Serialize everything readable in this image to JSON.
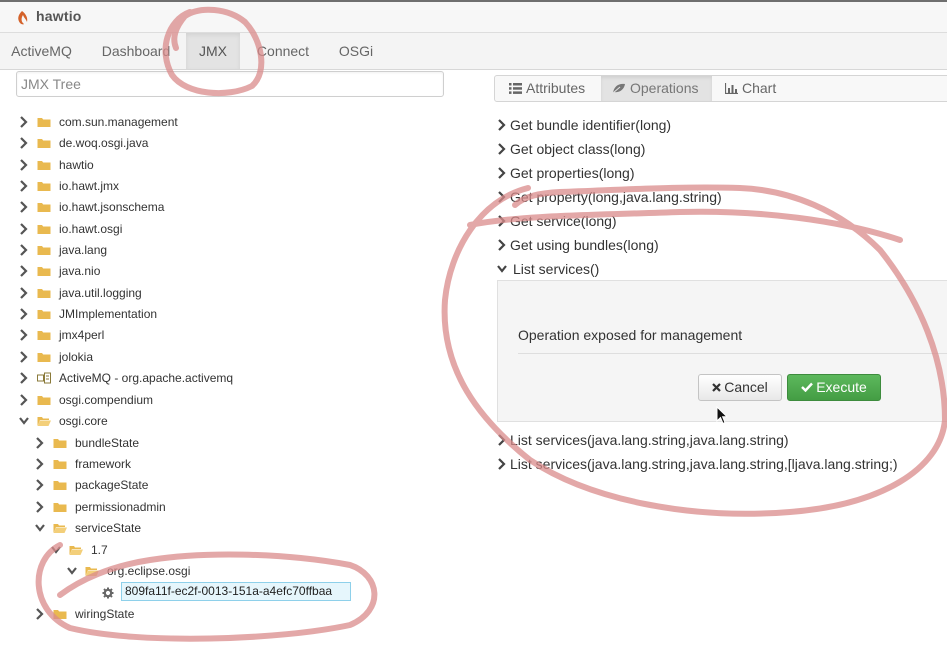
{
  "app": {
    "brand": "hawtio"
  },
  "nav": {
    "tabs": [
      {
        "label": "ActiveMQ"
      },
      {
        "label": "Dashboard"
      },
      {
        "label": "JMX",
        "active": true
      },
      {
        "label": "Connect"
      },
      {
        "label": "OSGi"
      }
    ]
  },
  "tree": {
    "title": "JMX Tree",
    "items": [
      {
        "label": "com.sun.management"
      },
      {
        "label": "de.woq.osgi.java"
      },
      {
        "label": "hawtio"
      },
      {
        "label": "io.hawt.jmx"
      },
      {
        "label": "io.hawt.jsonschema"
      },
      {
        "label": "io.hawt.osgi"
      },
      {
        "label": "java.lang"
      },
      {
        "label": "java.nio"
      },
      {
        "label": "java.util.logging"
      },
      {
        "label": "JMImplementation"
      },
      {
        "label": "jmx4perl"
      },
      {
        "label": "jolokia"
      },
      {
        "label": "ActiveMQ - org.apache.activemq"
      },
      {
        "label": "osgi.compendium"
      },
      {
        "label": "osgi.core"
      },
      {
        "label": "bundleState"
      },
      {
        "label": "framework"
      },
      {
        "label": "packageState"
      },
      {
        "label": "permissionadmin"
      },
      {
        "label": "serviceState"
      },
      {
        "label": "1.7"
      },
      {
        "label": "org.eclipse.osgi"
      },
      {
        "label": "809fa11f-ec2f-0013-151a-a4efc70ffbaa"
      },
      {
        "label": "wiringState"
      }
    ]
  },
  "detail": {
    "tabs": [
      {
        "label": "Attributes",
        "icon": "list-icon"
      },
      {
        "label": "Operations",
        "icon": "leaf-icon",
        "active": true
      },
      {
        "label": "Chart",
        "icon": "bar-chart-icon"
      }
    ],
    "operations": [
      {
        "label": "Get bundle identifier(long)"
      },
      {
        "label": "Get object class(long)"
      },
      {
        "label": "Get properties(long)"
      },
      {
        "label": "Get property(long,java.lang.string)"
      },
      {
        "label": "Get service(long)"
      },
      {
        "label": "Get using bundles(long)"
      },
      {
        "label": "List services()",
        "expanded": true
      },
      {
        "label": "List services(java.lang.string,java.lang.string)"
      },
      {
        "label": "List services(java.lang.string,java.lang.string,[ljava.lang.string;)"
      }
    ],
    "expanded_panel": {
      "description": "Operation exposed for management",
      "cancel_label": "Cancel",
      "execute_label": "Execute"
    }
  },
  "colors": {
    "folder": "#e9b94f",
    "execute": "#5cb85c",
    "annotation": "#d98b8b",
    "selection": "#e6f6fc"
  }
}
